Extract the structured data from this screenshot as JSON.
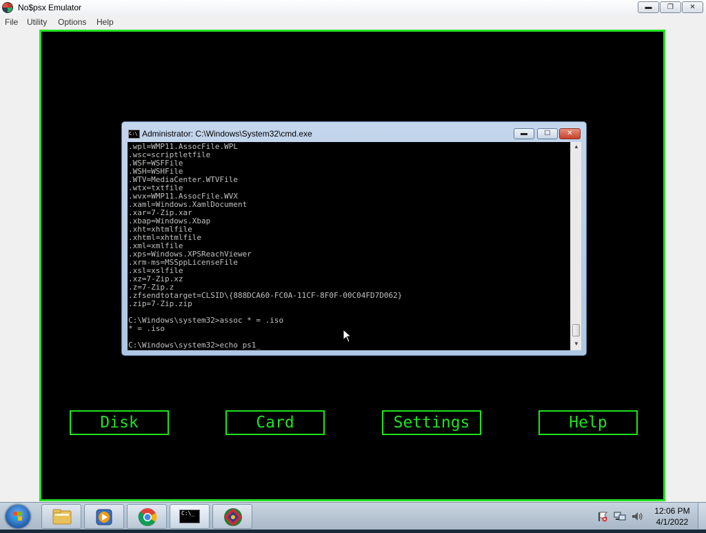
{
  "app": {
    "title": "No$psx Emulator",
    "window_controls": {
      "minimize": "▬",
      "maximize": "❐",
      "close": "✕"
    }
  },
  "menu": [
    "File",
    "Utility",
    "Options",
    "Help"
  ],
  "emulator": {
    "accent_color": "#22e022",
    "buttons": [
      "Disk",
      "Card",
      "Settings",
      "Help"
    ]
  },
  "cmd": {
    "title": "Administrator: C:\\Windows\\System32\\cmd.exe",
    "icon_text": "C:\\",
    "lines": [
      ".wpl=WMP11.AssocFile.WPL",
      ".wsc=scriptletfile",
      ".WSF=WSFFile",
      ".WSH=WSHFile",
      ".WTV=MediaCenter.WTVFile",
      ".wtx=txtfile",
      ".wvx=WMP11.AssocFile.WVX",
      ".xaml=Windows.XamlDocument",
      ".xar=7-Zip.xar",
      ".xbap=Windows.Xbap",
      ".xht=xhtmlfile",
      ".xhtml=xhtmlfile",
      ".xml=xmlfile",
      ".xps=Windows.XPSReachViewer",
      ".xrm-ms=MSSppLicenseFile",
      ".xsl=xslfile",
      ".xz=7-Zip.xz",
      ".z=7-Zip.z",
      ".zfsendtotarget=CLSID\\{888DCA60-FC0A-11CF-8F0F-00C04FD7D062}",
      ".zip=7-Zip.zip",
      "",
      "C:\\Windows\\system32>assoc * = .iso",
      "* = .iso",
      "",
      "C:\\Windows\\system32>echo ps1_"
    ]
  },
  "taskbar": {
    "apps": [
      "windows-explorer",
      "media-player",
      "chrome",
      "command-prompt",
      "no$psx-emulator"
    ],
    "cmd_icon_text": "C:\\_",
    "clock": {
      "time": "12:06 PM",
      "date": "4/1/2022"
    }
  }
}
